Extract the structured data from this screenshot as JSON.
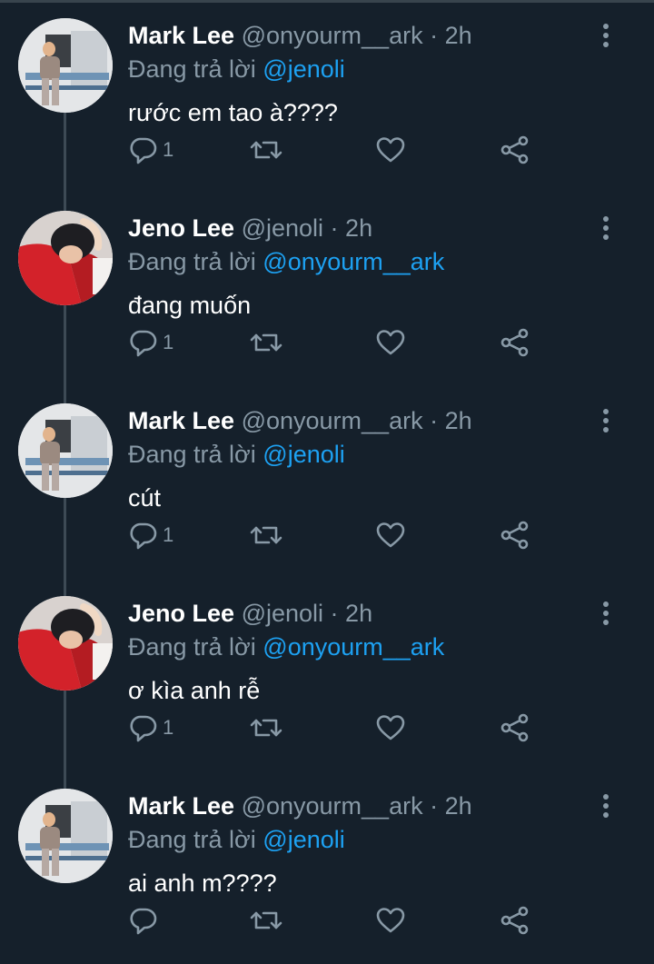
{
  "reply_prefix": "Đang trả lời",
  "tweets": [
    {
      "name": "Mark Lee",
      "handle": "@onyourm__ark",
      "time": "2h",
      "reply_to": "@jenoli",
      "text": "rước em tao à????",
      "replies": "1",
      "avatar": "mark"
    },
    {
      "name": "Jeno Lee",
      "handle": "@jenoli",
      "time": "2h",
      "reply_to": "@onyourm__ark",
      "text": "đang muốn",
      "replies": "1",
      "avatar": "jeno"
    },
    {
      "name": "Mark Lee",
      "handle": "@onyourm__ark",
      "time": "2h",
      "reply_to": "@jenoli",
      "text": "cút",
      "replies": "1",
      "avatar": "mark"
    },
    {
      "name": "Jeno Lee",
      "handle": "@jenoli",
      "time": "2h",
      "reply_to": "@onyourm__ark",
      "text": "ơ kìa anh rễ",
      "replies": "1",
      "avatar": "jeno"
    },
    {
      "name": "Mark Lee",
      "handle": "@onyourm__ark",
      "time": "2h",
      "reply_to": "@jenoli",
      "text": "ai anh m????",
      "replies": "",
      "avatar": "mark"
    }
  ],
  "icons": {
    "reply": "reply-icon",
    "retweet": "retweet-icon",
    "like": "like-icon",
    "share": "share-icon",
    "more": "more-vertical-icon"
  },
  "colors": {
    "background": "#15202b",
    "secondary_text": "#8899a6",
    "link": "#1da1f2",
    "thread_line": "#3d4a55"
  }
}
